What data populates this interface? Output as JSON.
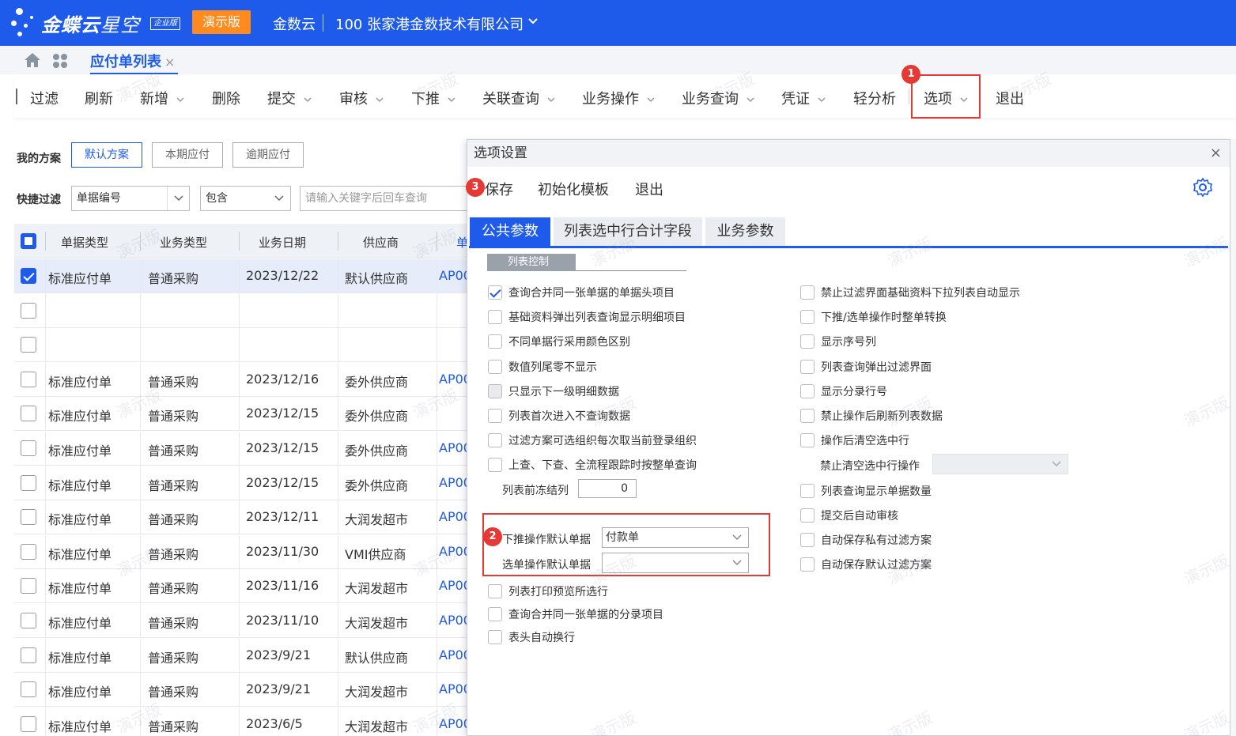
{
  "topbar": {
    "brand": "金蝶云",
    "brand_product": "星空",
    "brand_edition": "企业版",
    "demo_badge": "演示版",
    "org": "金数云",
    "company": "100 张家港金数技术有限公司"
  },
  "tabs": {
    "page_tab": "应付单列表",
    "close": "×"
  },
  "toolbar": {
    "items": [
      "过滤",
      "刷新",
      "新增",
      "删除",
      "提交",
      "审核",
      "下推",
      "关联查询",
      "业务操作",
      "业务查询",
      "凭证",
      "轻分析",
      "选项",
      "退出"
    ],
    "badge_1": "1"
  },
  "filters": {
    "scheme_label": "我的方案",
    "schemes": [
      "默认方案",
      "本期应付",
      "逾期应付"
    ],
    "quick_filter_label": "快捷过滤",
    "field_select": "单据编号",
    "operator_select": "包含",
    "keyword_placeholder": "请输入关键字后回车查询"
  },
  "grid": {
    "columns": [
      "单据类型",
      "业务类型",
      "业务日期",
      "供应商",
      "单"
    ],
    "rows": [
      {
        "checked": true,
        "type": "标准应付单",
        "biz": "普通采购",
        "date": "2023/12/22",
        "supplier": "默认供应商",
        "code": "AP00"
      },
      {
        "checked": false,
        "type": "",
        "biz": "",
        "date": "",
        "supplier": "",
        "code": ""
      },
      {
        "checked": false,
        "type": "",
        "biz": "",
        "date": "",
        "supplier": "",
        "code": ""
      },
      {
        "checked": false,
        "type": "标准应付单",
        "biz": "普通采购",
        "date": "2023/12/16",
        "supplier": "委外供应商",
        "code": "AP00"
      },
      {
        "checked": false,
        "type": "标准应付单",
        "biz": "普通采购",
        "date": "2023/12/15",
        "supplier": "委外供应商",
        "code": ""
      },
      {
        "checked": false,
        "type": "标准应付单",
        "biz": "普通采购",
        "date": "2023/12/15",
        "supplier": "委外供应商",
        "code": "AP00"
      },
      {
        "checked": false,
        "type": "标准应付单",
        "biz": "普通采购",
        "date": "2023/12/15",
        "supplier": "委外供应商",
        "code": "AP00"
      },
      {
        "checked": false,
        "type": "标准应付单",
        "biz": "普通采购",
        "date": "2023/12/11",
        "supplier": "大润发超市",
        "code": "AP00"
      },
      {
        "checked": false,
        "type": "标准应付单",
        "biz": "普通采购",
        "date": "2023/11/30",
        "supplier": "VMI供应商",
        "code": "AP00"
      },
      {
        "checked": false,
        "type": "标准应付单",
        "biz": "普通采购",
        "date": "2023/11/16",
        "supplier": "大润发超市",
        "code": "AP00"
      },
      {
        "checked": false,
        "type": "标准应付单",
        "biz": "普通采购",
        "date": "2023/11/10",
        "supplier": "大润发超市",
        "code": "AP00"
      },
      {
        "checked": false,
        "type": "标准应付单",
        "biz": "普通采购",
        "date": "2023/9/21",
        "supplier": "默认供应商",
        "code": "AP00"
      },
      {
        "checked": false,
        "type": "标准应付单",
        "biz": "普通采购",
        "date": "2023/9/21",
        "supplier": "大润发超市",
        "code": "AP00"
      },
      {
        "checked": false,
        "type": "标准应付单",
        "biz": "普通采购",
        "date": "2023/6/5",
        "supplier": "大润发超市",
        "code": "AP00"
      }
    ]
  },
  "dialog": {
    "title": "选项设置",
    "close": "×",
    "menu": [
      "保存",
      "初始化模板",
      "退出"
    ],
    "badge_3": "3",
    "tabs": [
      "公共参数",
      "列表选中行合计字段",
      "业务参数"
    ],
    "section": "列表控制",
    "left_options": [
      {
        "label": "查询合并同一张单据的单据头项目",
        "checked": true
      },
      {
        "label": "基础资料弹出列表查询显示明细项目",
        "checked": false
      },
      {
        "label": "不同单据行采用颜色区别",
        "checked": false
      },
      {
        "label": "数值列尾零不显示",
        "checked": false
      },
      {
        "label": "只显示下一级明细数据",
        "checked": false
      },
      {
        "label": "列表首次进入不查询数据",
        "checked": false
      },
      {
        "label": "过滤方案可选组织每次取当前登录组织",
        "checked": false
      },
      {
        "label": "上查、下查、全流程跟踪时按整单查询",
        "checked": false
      }
    ],
    "freeze_label": "列表前冻结列",
    "freeze_value": "0",
    "push_label": "下推操作默认单据",
    "push_value": "付款单",
    "select_label": "选单操作默认单据",
    "select_value": "",
    "badge_2": "2",
    "left_options_bottom": [
      {
        "label": "列表打印预览所选行",
        "checked": false
      },
      {
        "label": "查询合并同一张单据的分录项目",
        "checked": false
      },
      {
        "label": "表头自动换行",
        "checked": false
      }
    ],
    "right_options": [
      {
        "label": "禁止过滤界面基础资料下拉列表自动显示",
        "checked": false
      },
      {
        "label": "下推/选单操作时整单转换",
        "checked": false
      },
      {
        "label": "显示序号列",
        "checked": false
      },
      {
        "label": "列表查询弹出过滤界面",
        "checked": false
      },
      {
        "label": "显示分录行号",
        "checked": false
      },
      {
        "label": "禁止操作后刷新列表数据",
        "checked": false
      },
      {
        "label": "操作后清空选中行",
        "checked": false
      }
    ],
    "clear_sel_label": "禁止清空选中行操作",
    "right_options_bottom": [
      {
        "label": "列表查询显示单据数量",
        "checked": false
      },
      {
        "label": "提交后自动审核",
        "checked": false
      },
      {
        "label": "自动保存私有过滤方案",
        "checked": false
      },
      {
        "label": "自动保存默认过滤方案",
        "checked": false
      }
    ]
  },
  "watermark": "演示版",
  "colors": {
    "primary": "#1e5bea",
    "highlight": "#e53935",
    "demo": "#ff8a1e"
  }
}
